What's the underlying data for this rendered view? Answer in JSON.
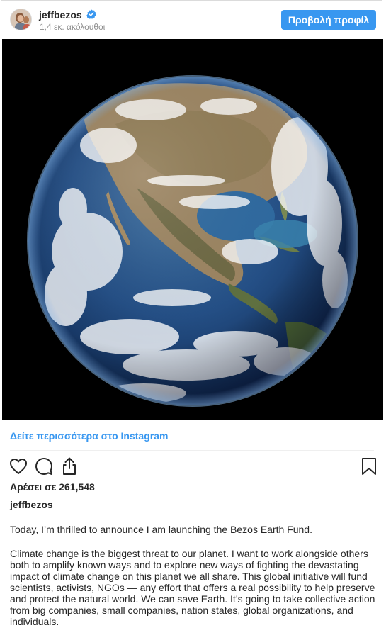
{
  "post": {
    "username": "jeffbezos",
    "followers": "1,4 εκ. ακόλουθοι",
    "profile_button": "Προβολή προφίλ",
    "see_more": "Δείτε περισσότερα στο Instagram",
    "likes": "Αρέσει σε 261,548",
    "caption_user": "jeffbezos",
    "caption_p1": "Today, I’m thrilled to announce I am launching the Bezos Earth Fund.",
    "caption_p2": "Climate change is the biggest threat to our planet. I want to work alongside others\nboth to amplify known ways and to explore new ways of fighting the devastating\nimpact of climate change on this planet we all share. This global initiative will fund\nscientists, activists, NGOs — any effort that offers a real possibility to help preserve\nand protect the natural world. We can save Earth. It’s going to take collective action\nfrom big companies, small companies, nation states, global organizations, and\nindividuals."
  },
  "icons": {
    "avatar": "avatar",
    "verified": "verified-badge-icon",
    "like": "heart-icon",
    "comment": "comment-icon",
    "share": "share-icon",
    "save": "bookmark-icon"
  },
  "colors": {
    "accent": "#3897f0",
    "text": "#262626",
    "muted": "#8e8e8e",
    "border": "#dbdbdb"
  }
}
